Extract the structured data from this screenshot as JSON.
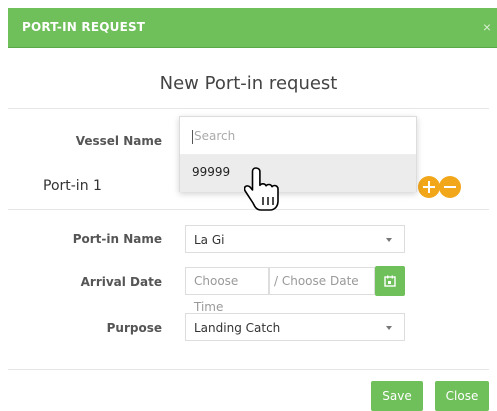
{
  "header": {
    "title": "PORT-IN REQUEST",
    "close_label": "×"
  },
  "modal": {
    "title": "New Port-in request"
  },
  "vessel": {
    "label": "Vessel Name",
    "search_placeholder": "Search",
    "options": [
      "99999"
    ]
  },
  "portin_section": {
    "title": "Port-in 1"
  },
  "form": {
    "portin_name_label": "Port-in Name",
    "portin_name_value": "La Gi",
    "arrival_date_label": "Arrival Date",
    "time_placeholder": "Choose Time",
    "date_placeholder": "/ Choose Date",
    "purpose_label": "Purpose",
    "purpose_value": "Landing Catch"
  },
  "footer": {
    "save_label": "Save",
    "close_label": "Close"
  },
  "colors": {
    "accent": "#6fbf5a",
    "warning": "#f2a71b"
  }
}
